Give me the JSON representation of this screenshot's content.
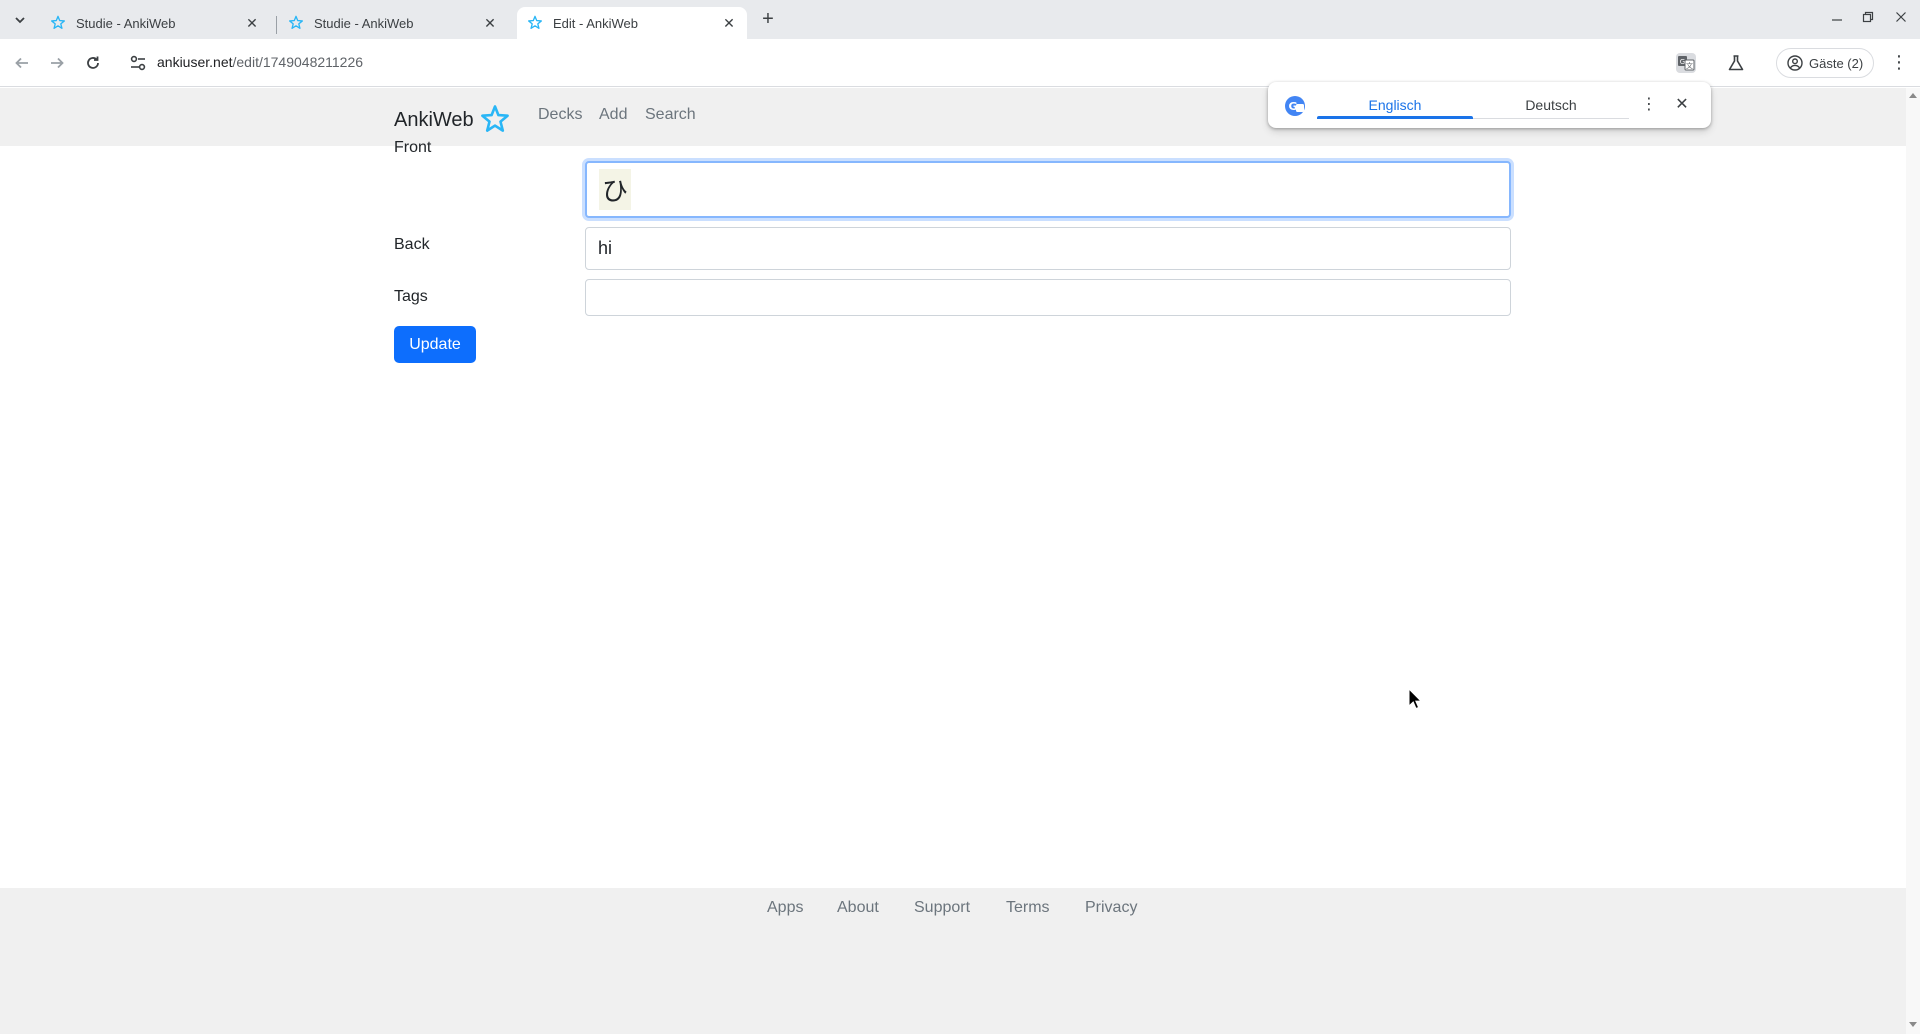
{
  "browser": {
    "tabs": [
      {
        "title": "Studie - AnkiWeb",
        "active": false
      },
      {
        "title": "Studie - AnkiWeb",
        "active": false
      },
      {
        "title": "Edit - AnkiWeb",
        "active": true
      }
    ],
    "url_domain": "ankiuser.net",
    "url_path": "/edit/1749048211226",
    "profile_label": "Gäste (2)"
  },
  "translate_bar": {
    "source_lang": "Englisch",
    "target_lang": "Deutsch"
  },
  "navbar": {
    "brand": "AnkiWeb",
    "links": [
      "Decks",
      "Add",
      "Search"
    ]
  },
  "form": {
    "front_label": "Front",
    "front_value": "ひ",
    "back_label": "Back",
    "back_value": "hi",
    "tags_label": "Tags",
    "tags_value": "",
    "update_label": "Update"
  },
  "footer": {
    "links": [
      "Apps",
      "About",
      "Support",
      "Terms",
      "Privacy"
    ]
  },
  "colors": {
    "accent": "#0d6efd",
    "brand_star": "#29b6f6",
    "navbar_bg": "#f0f0f0"
  }
}
